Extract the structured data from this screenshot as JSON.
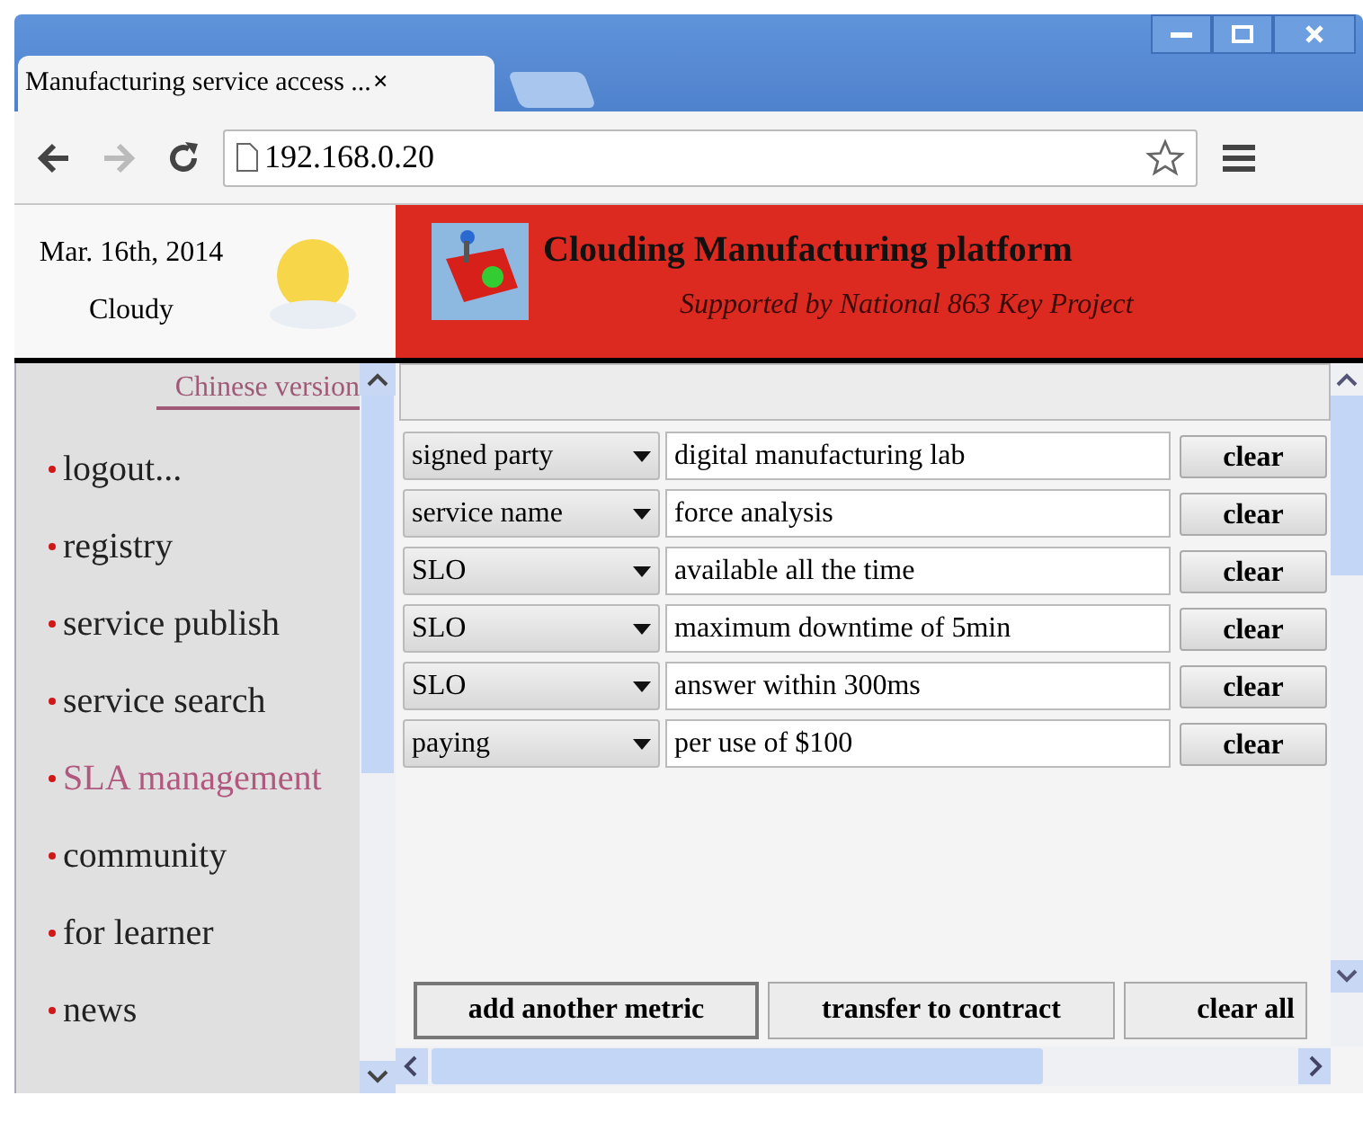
{
  "tab": {
    "title": "Manufacturing service access ...",
    "close": "×"
  },
  "address_bar": {
    "url": "192.168.0.20"
  },
  "weather": {
    "date": "Mar. 16th, 2014",
    "condition": "Cloudy"
  },
  "banner": {
    "title": "Clouding Manufacturing platform",
    "subtitle": "Supported by National 863 Key Project"
  },
  "language_link": "Chinese version",
  "nav": [
    {
      "label": "logout...",
      "selected": false
    },
    {
      "label": "registry",
      "selected": false
    },
    {
      "label": "service publish",
      "selected": false
    },
    {
      "label": "service search",
      "selected": false
    },
    {
      "label": "SLA management",
      "selected": true
    },
    {
      "label": "community",
      "selected": false
    },
    {
      "label": "for learner",
      "selected": false
    },
    {
      "label": "news",
      "selected": false
    }
  ],
  "metrics": [
    {
      "type": "signed party",
      "value": "digital manufacturing lab",
      "button": "clear"
    },
    {
      "type": "service name",
      "value": "force analysis",
      "button": "clear"
    },
    {
      "type": "SLO",
      "value": "available all the time",
      "button": "clear"
    },
    {
      "type": "SLO",
      "value": "maximum downtime of 5min",
      "button": "clear"
    },
    {
      "type": "SLO",
      "value": "answer within 300ms",
      "button": "clear"
    },
    {
      "type": "paying",
      "value": "per use of $100",
      "button": "clear"
    }
  ],
  "actions": [
    "add another metric",
    "transfer to contract",
    "clear all"
  ]
}
